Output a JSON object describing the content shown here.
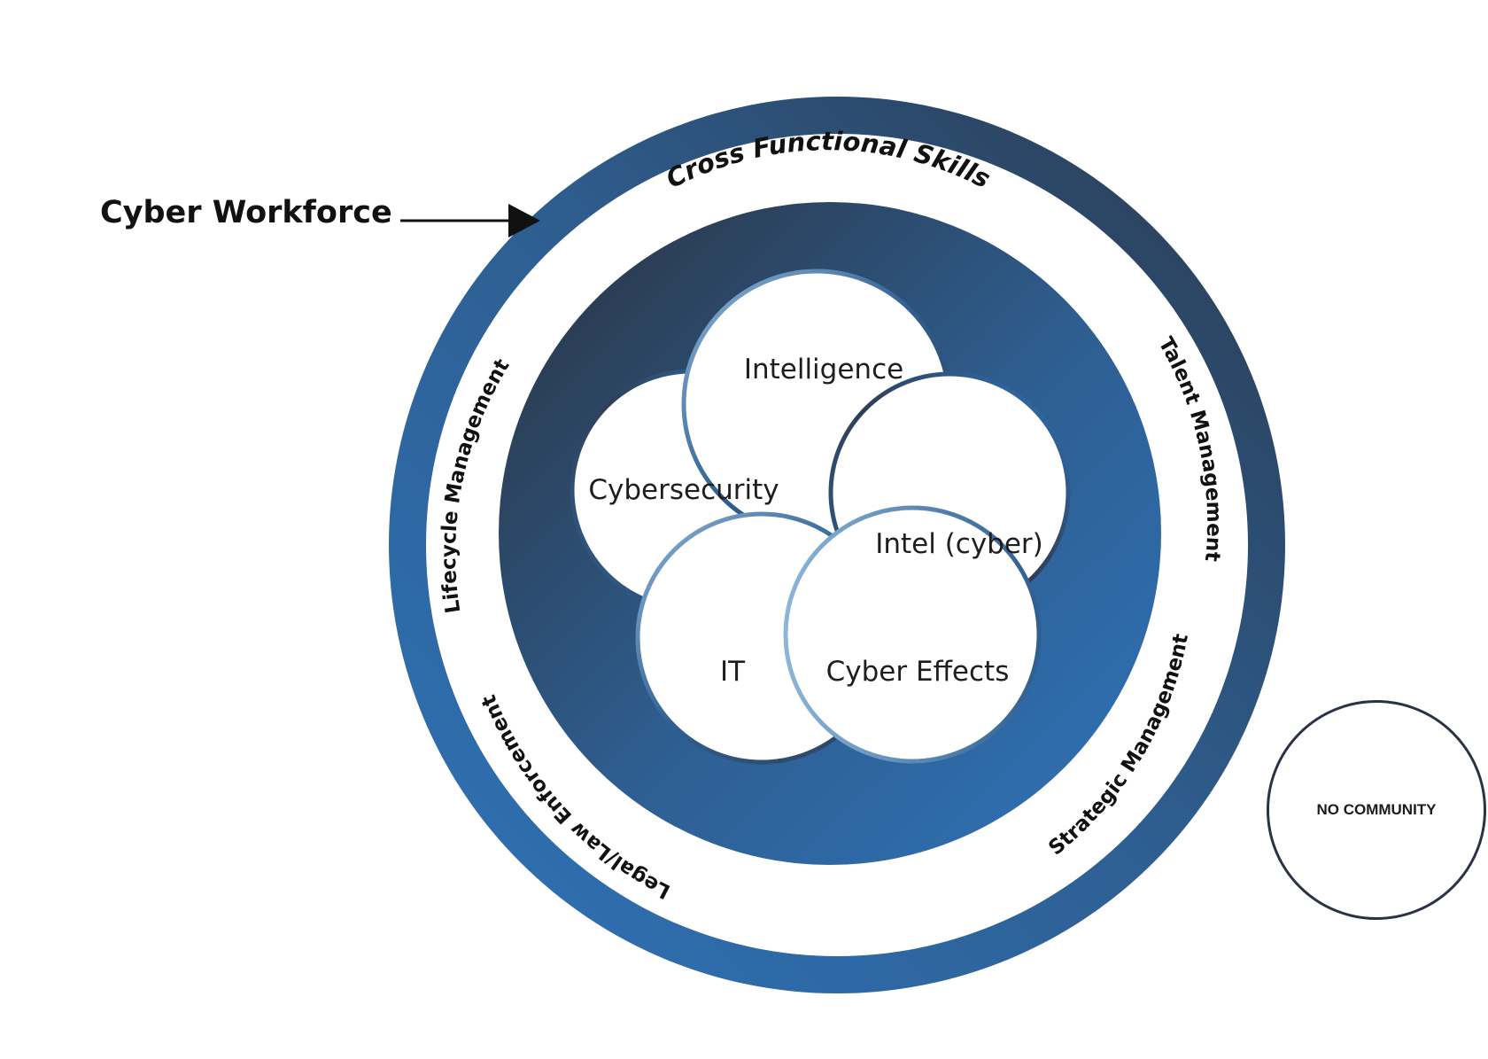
{
  "heading": "Cyber Workforce",
  "ring_labels": {
    "top": "Cross Functional Skills",
    "left": "Lifecycle Management",
    "right": "Talent Management",
    "bottom_right": "Strategic Management",
    "bottom_left": "Legal/Law Enforcement"
  },
  "communities": {
    "intelligence": "Intelligence",
    "cybersecurity": "Cybersecurity",
    "intel_cyber": "Intel (cyber)",
    "it": "IT",
    "cyber_effects": "Cyber Effects"
  },
  "no_community": "NO COMMUNITY",
  "colors": {
    "ring_dark": "#2b3a4f",
    "ring_blue": "#2f73b9",
    "ring_mid": "#2e5f92",
    "petal_border_dark": "#2f3e55",
    "petal_border_light": "#8cb5d8",
    "text": "#111111"
  }
}
